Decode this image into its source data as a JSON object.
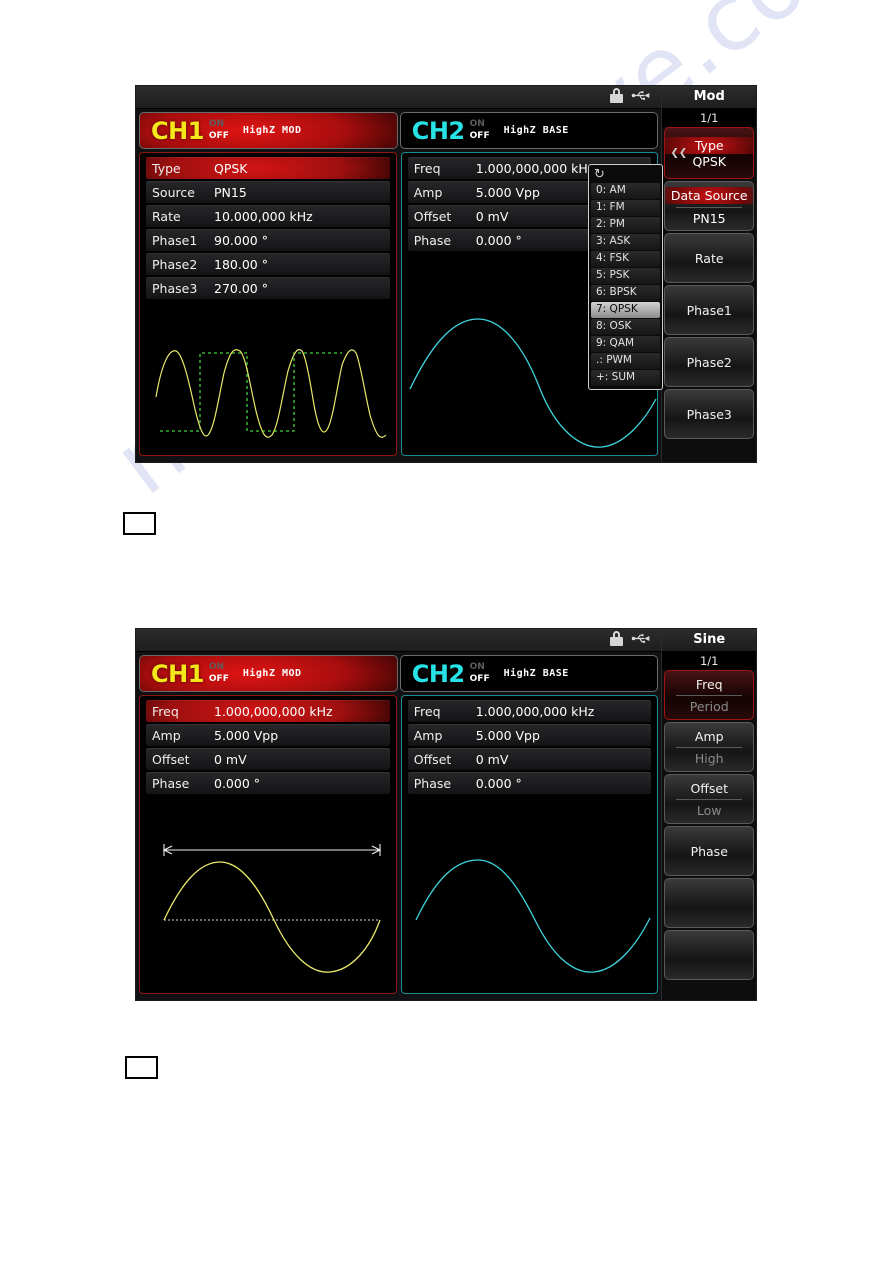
{
  "watermark": {
    "text": "manualarchive.com"
  },
  "screens": [
    {
      "id": "screen-mod",
      "statusbar": {
        "lock_icon": "lock-icon",
        "usb_icon": "usb-icon"
      },
      "channels": [
        {
          "name": "CH1",
          "on_label": "ON",
          "off_label": "OFF",
          "mode": "HighZ  MOD",
          "params": [
            {
              "key": "Type",
              "value": "QPSK",
              "highlight": true
            },
            {
              "key": "Source",
              "value": "PN15",
              "highlight": false
            },
            {
              "key": "Rate",
              "value": "10.000,000 kHz",
              "highlight": false
            },
            {
              "key": "Phase1",
              "value": "90.000 °",
              "highlight": false
            },
            {
              "key": "Phase2",
              "value": "180.00 °",
              "highlight": false
            },
            {
              "key": "Phase3",
              "value": "270.00 °",
              "highlight": false
            }
          ],
          "waveform": "qpsk-modulated-sine",
          "trace_color": "#e8e86a",
          "data_color": "#44d13a"
        },
        {
          "name": "CH2",
          "on_label": "ON",
          "off_label": "OFF",
          "mode": "HighZ  BASE",
          "params": [
            {
              "key": "Freq",
              "value": "1.000,000,000 kHz",
              "highlight": false
            },
            {
              "key": "Amp",
              "value": "5.000 Vpp",
              "highlight": false
            },
            {
              "key": "Offset",
              "value": "0 mV",
              "highlight": false
            },
            {
              "key": "Phase",
              "value": "0.000 °",
              "highlight": false
            }
          ],
          "waveform": "sine",
          "trace_color": "#3fd6e0"
        }
      ],
      "dropdown": {
        "scroll_icon": "↻",
        "items": [
          {
            "label": "0: AM",
            "selected": false
          },
          {
            "label": "1: FM",
            "selected": false
          },
          {
            "label": "2: PM",
            "selected": false
          },
          {
            "label": "3: ASK",
            "selected": false
          },
          {
            "label": "4: FSK",
            "selected": false
          },
          {
            "label": "5: PSK",
            "selected": false
          },
          {
            "label": "6: BPSK",
            "selected": false
          },
          {
            "label": "7: QPSK",
            "selected": true
          },
          {
            "label": "8: OSK",
            "selected": false
          },
          {
            "label": "9: QAM",
            "selected": false
          },
          {
            "label": ".: PWM",
            "selected": false
          },
          {
            "label": "+: SUM",
            "selected": false
          }
        ]
      },
      "sidemenu": {
        "title": "Mod",
        "page": "1/1",
        "buttons": [
          {
            "label": "Type",
            "sub": "QPSK",
            "active": true,
            "red_label": true,
            "chevron": true,
            "dim_sub": false
          },
          {
            "label": "Data Source",
            "sub": "PN15",
            "active": false,
            "red_label": true,
            "chevron": false,
            "dim_sub": false
          },
          {
            "label": "Rate",
            "sub": "",
            "active": false,
            "red_label": false,
            "chevron": false,
            "dim_sub": false
          },
          {
            "label": "Phase1",
            "sub": "",
            "active": false,
            "red_label": false,
            "chevron": false,
            "dim_sub": false
          },
          {
            "label": "Phase2",
            "sub": "",
            "active": false,
            "red_label": false,
            "chevron": false,
            "dim_sub": false
          },
          {
            "label": "Phase3",
            "sub": "",
            "active": false,
            "red_label": false,
            "chevron": false,
            "dim_sub": false
          }
        ]
      }
    },
    {
      "id": "screen-sine",
      "statusbar": {
        "lock_icon": "lock-icon",
        "usb_icon": "usb-icon"
      },
      "channels": [
        {
          "name": "CH1",
          "on_label": "ON",
          "off_label": "OFF",
          "mode": "HighZ  MOD",
          "params": [
            {
              "key": "Freq",
              "value": "1.000,000,000 kHz",
              "highlight": true
            },
            {
              "key": "Amp",
              "value": "5.000 Vpp",
              "highlight": false
            },
            {
              "key": "Offset",
              "value": "0 mV",
              "highlight": false
            },
            {
              "key": "Phase",
              "value": "0.000 °",
              "highlight": false
            }
          ],
          "waveform": "sine-with-period-marker",
          "trace_color": "#e8e86a"
        },
        {
          "name": "CH2",
          "on_label": "ON",
          "off_label": "OFF",
          "mode": "HighZ  BASE",
          "params": [
            {
              "key": "Freq",
              "value": "1.000,000,000 kHz",
              "highlight": false
            },
            {
              "key": "Amp",
              "value": "5.000 Vpp",
              "highlight": false
            },
            {
              "key": "Offset",
              "value": "0 mV",
              "highlight": false
            },
            {
              "key": "Phase",
              "value": "0.000 °",
              "highlight": false
            }
          ],
          "waveform": "sine",
          "trace_color": "#3fd6e0"
        }
      ],
      "sidemenu": {
        "title": "Sine",
        "page": "1/1",
        "buttons": [
          {
            "label": "Freq",
            "sub": "Period",
            "active": true,
            "red_label": false,
            "chevron": false,
            "dim_sub": true
          },
          {
            "label": "Amp",
            "sub": "High",
            "active": false,
            "red_label": false,
            "chevron": false,
            "dim_sub": true
          },
          {
            "label": "Offset",
            "sub": "Low",
            "active": false,
            "red_label": false,
            "chevron": false,
            "dim_sub": true
          },
          {
            "label": "Phase",
            "sub": "",
            "active": false,
            "red_label": false,
            "chevron": false,
            "dim_sub": false
          },
          {
            "label": "",
            "sub": "",
            "active": false,
            "red_label": false,
            "chevron": false,
            "dim_sub": false
          },
          {
            "label": "",
            "sub": "",
            "active": false,
            "red_label": false,
            "chevron": false,
            "dim_sub": false
          }
        ]
      }
    }
  ],
  "placeholders": [
    {
      "name": "placeholder-box-1"
    },
    {
      "name": "placeholder-box-2"
    }
  ],
  "colors": {
    "ch1_accent": "#d21414",
    "ch2_accent": "#27e3e8",
    "ch1_trace": "#e8e86a",
    "ch2_trace": "#3fd6e0",
    "data_trace": "#44d13a",
    "watermark": "#c9cfee"
  }
}
